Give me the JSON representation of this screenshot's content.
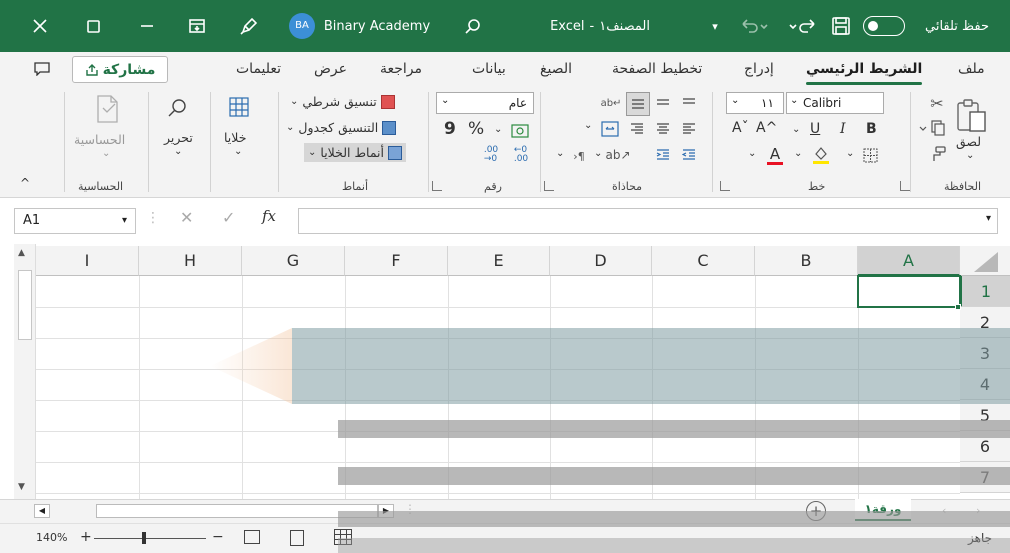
{
  "window": {
    "autosave_label": "حفظ تلقائي",
    "filename": "المصنف١",
    "app_name": "Excel",
    "separator": "-",
    "user_initials": "BA",
    "user_name": "Binary Academy"
  },
  "tabs": [
    "ملف",
    "الشريط الرئيسي",
    "إدراج",
    "تخطيط الصفحة",
    "الصيغ",
    "بيانات",
    "مراجعة",
    "عرض",
    "تعليمات"
  ],
  "active_tab": "الشريط الرئيسي",
  "share_label": "مشاركة",
  "ribbon": {
    "clipboard": {
      "group": "الحافظة",
      "paste": "لصق"
    },
    "font": {
      "group": "خط",
      "font_name": "Calibri",
      "font_size": "١١",
      "bold": "B",
      "italic": "I",
      "underline": "U",
      "grow": "A^",
      "shrink": "Aˇ",
      "font_color_letter": "A"
    },
    "alignment": {
      "group": "محاذاة"
    },
    "number": {
      "group": "رقم",
      "format": "عام",
      "percent": "%",
      "comma": "9"
    },
    "styles": {
      "group": "أنماط",
      "conditional": "تنسيق شرطي",
      "as_table": "التنسيق كجدول",
      "cell_styles": "أنماط الخلايا"
    },
    "cells": {
      "label": "خلايا"
    },
    "editing": {
      "label": "تحرير"
    },
    "sensitivity": {
      "label": "الحساسية",
      "group": "الحساسية"
    }
  },
  "formula_bar": {
    "cell_ref": "A1",
    "fx": "fx",
    "value": ""
  },
  "columns": [
    "A",
    "B",
    "C",
    "D",
    "E",
    "F",
    "G",
    "H",
    "I"
  ],
  "selected_column": "A",
  "rows": [
    "1",
    "2",
    "3",
    "4",
    "5",
    "6",
    "7"
  ],
  "selected_row": "1",
  "sheet_tab": "ورقة١",
  "status": {
    "ready": "جاهز",
    "zoom": "140%"
  },
  "colors": {
    "accent": "#217346",
    "highlight_teal": "#7f9ca3",
    "highlight_gray": "#9a9a9a",
    "marker_orange": "#f4c9a6"
  }
}
